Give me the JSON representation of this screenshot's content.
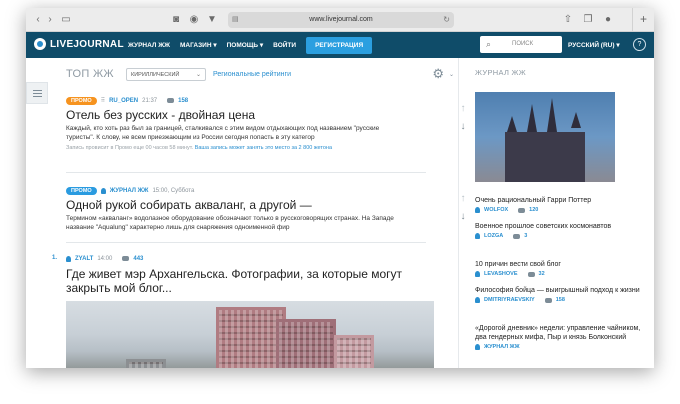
{
  "browser": {
    "url": "www.livejournal.com",
    "plus": "+"
  },
  "nav": {
    "logo": "LIVEJOURNAL",
    "items": [
      "ЖУРНАЛ ЖЖ",
      "МАГАЗИН ▾",
      "ПОМОЩЬ ▾",
      "ВОЙТИ"
    ],
    "register": "РЕГИСТРАЦИЯ",
    "search_placeholder": "ПОИСК",
    "language": "РУССКИЙ (RU) ▾",
    "help": "?"
  },
  "top": {
    "title": "ТОП ЖЖ",
    "filter": "КИРИЛЛИЧЕСКИЙ",
    "regional_link": "Региональные рейтинги"
  },
  "posts": [
    {
      "badge": "ПРОМО",
      "author": "RU_OPEN",
      "time": "21:37",
      "comments": "158",
      "title": "Отель без русских - двойная цена",
      "excerpt": "Каждый, кто хоть раз был за границей, сталкивался с этим видом отдыхающих под названием \"русские туристы\". К слову, не всем приезжающим из России сегодня попасть в эту категор",
      "note_prefix": "Запись провисит в Промо еще 00 часов 58 минут.",
      "note_link": "Ваша запись может занять это место за 2 800 жетона"
    },
    {
      "badge": "ПРОМО",
      "author": "ЖУРНАЛ ЖЖ",
      "time": "15:00, Суббота",
      "title": "Одной рукой собирать акваланг, а другой —",
      "excerpt": "Термином «акваланг» водолазное оборудование обозначают только в русскоговорящих странах. На Западе название \"Aqualung\" характерно лишь для снаряжения одноименной фир"
    },
    {
      "rank": "1.",
      "author": "ZYALT",
      "time": "14:00",
      "comments": "443",
      "title": "Где живет мэр Архангельска. Фотографии, за которые могут закрыть мой блог..."
    }
  ],
  "right": {
    "header": "ЖУРНАЛ ЖЖ",
    "items": [
      {
        "title": "Очень рациональный Гарри Поттер",
        "author": "WOLFOX",
        "comments": "120"
      },
      {
        "title": "Военное прошлое советских космонавтов",
        "author": "LOZGA",
        "comments": "3"
      },
      {
        "title": "10 причин вести свой блог",
        "author": "LEVASHOVE",
        "comments": "32"
      },
      {
        "title": "Философия бойца — выигрышный подход к жизни",
        "author": "DMITRIYRAEVSKIY",
        "comments": "158"
      },
      {
        "title": "«Дорогой дневник» недели: управление чайником, два гендерных мифа, Пыр и князь Болконский",
        "author": "ЖУРНАЛ ЖЖ",
        "comments": ""
      }
    ]
  },
  "colors": {
    "nav_bg": "#0f4c69",
    "accent": "#2a8fcf",
    "promo": "#f6931f",
    "register": "#2b9fe0"
  }
}
